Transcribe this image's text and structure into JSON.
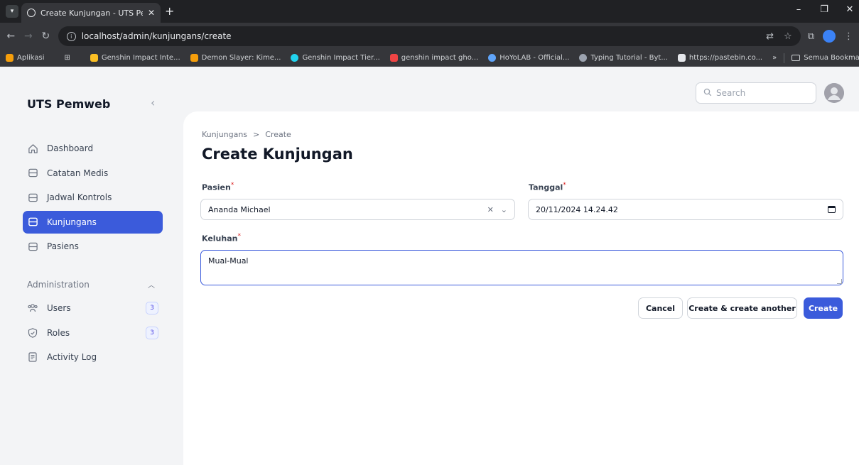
{
  "browser": {
    "tab_title": "Create Kunjungan - UTS Pemweb",
    "url": "localhost/admin/kunjungans/create",
    "bookmarks": [
      {
        "label": "Aplikasi",
        "color": "#f59e0b"
      },
      {
        "label": "Genshin Impact Inte...",
        "color": "#fbbf24"
      },
      {
        "label": "Demon Slayer: Kime...",
        "color": "#f59e0b"
      },
      {
        "label": "Genshin Impact Tier...",
        "color": "#22d3ee"
      },
      {
        "label": "genshin impact gho...",
        "color": "#ef4444"
      },
      {
        "label": "HoYoLAB - Official...",
        "color": "#60a5fa"
      },
      {
        "label": "Typing Tutorial - Byt...",
        "color": "#9ca3af"
      },
      {
        "label": "https://pastebin.co...",
        "color": "#e5e7eb"
      }
    ],
    "all_bookmarks_label": "Semua Bookmark"
  },
  "sidebar": {
    "brand": "UTS Pemweb",
    "items": [
      {
        "label": "Dashboard"
      },
      {
        "label": "Catatan Medis"
      },
      {
        "label": "Jadwal Kontrols"
      },
      {
        "label": "Kunjungans"
      },
      {
        "label": "Pasiens"
      }
    ],
    "group_label": "Administration",
    "admin_items": [
      {
        "label": "Users",
        "badge": "3"
      },
      {
        "label": "Roles",
        "badge": "3"
      },
      {
        "label": "Activity Log"
      }
    ]
  },
  "topbar": {
    "search_placeholder": "Search"
  },
  "page": {
    "breadcrumb": [
      "Kunjungans",
      "Create"
    ],
    "breadcrumb_separator": ">",
    "title": "Create Kunjungan",
    "form": {
      "pasien_label": "Pasien",
      "pasien_value": "Ananda Michael",
      "tanggal_label": "Tanggal",
      "tanggal_value": "20/11/2024 14.24.42",
      "keluhan_label": "Keluhan",
      "keluhan_value": "Mual-Mual",
      "required_mark": "*"
    },
    "actions": {
      "cancel": "Cancel",
      "create_another": "Create & create another",
      "create": "Create"
    }
  },
  "colors": {
    "primary": "#3b5bdb",
    "required": "#dc2626"
  }
}
